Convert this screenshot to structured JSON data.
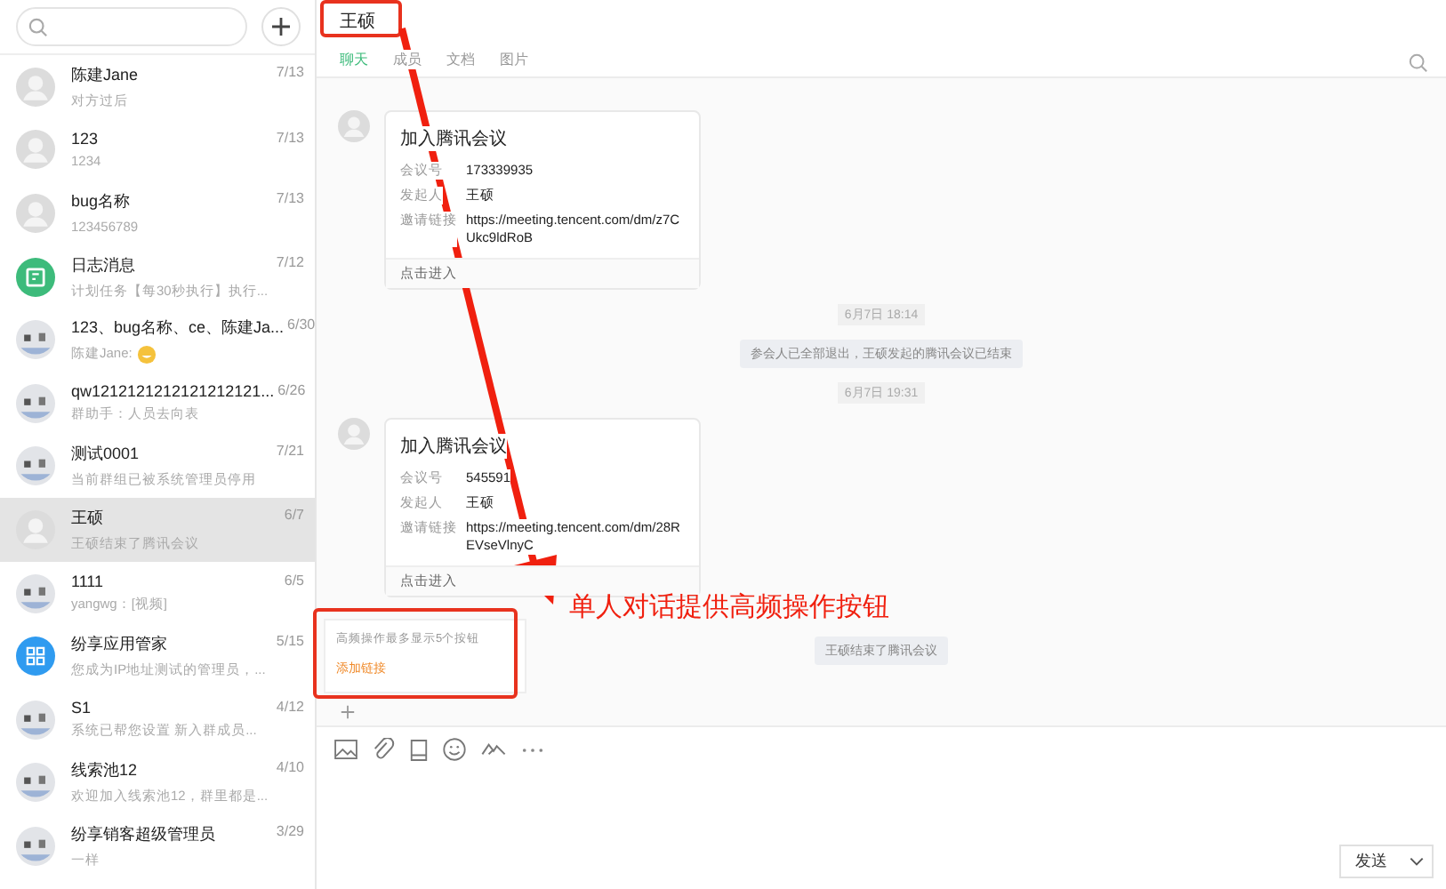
{
  "conversations": [
    {
      "name": "陈建Jane",
      "preview": "对方过后",
      "time": "7/13",
      "kind": "person",
      "selected": false
    },
    {
      "name": "123",
      "preview": "1234",
      "time": "7/13",
      "kind": "person",
      "selected": false
    },
    {
      "name": "bug名称",
      "preview": "123456789",
      "time": "7/13",
      "kind": "person",
      "selected": false
    },
    {
      "name": "日志消息",
      "preview": "计划任务【每30秒执行】执行...",
      "time": "7/12",
      "kind": "app-green",
      "selected": false
    },
    {
      "name": "123、bug名称、ce、陈建Ja...",
      "preview": "陈建Jane:",
      "emoji": true,
      "time": "6/30",
      "kind": "group",
      "selected": false
    },
    {
      "name": "qw1212121212121212121...",
      "preview": "群助手：人员去向表",
      "time": "6/26",
      "kind": "group",
      "selected": false
    },
    {
      "name": "测试0001",
      "preview": "当前群组已被系统管理员停用",
      "time": "7/21",
      "kind": "group",
      "selected": false
    },
    {
      "name": "王硕",
      "preview": "王硕结束了腾讯会议",
      "time": "6/7",
      "kind": "person",
      "selected": true
    },
    {
      "name": "1111",
      "preview": "yangwg：[视频]",
      "time": "6/5",
      "kind": "group",
      "selected": false
    },
    {
      "name": "纷享应用管家",
      "preview": "您成为IP地址测试的管理员，...",
      "time": "5/15",
      "kind": "app-blue",
      "selected": false
    },
    {
      "name": "S1",
      "preview": "系统已帮您设置 新入群成员...",
      "time": "4/12",
      "kind": "group",
      "selected": false
    },
    {
      "name": "线索池12",
      "preview": "欢迎加入线索池12，群里都是...",
      "time": "4/10",
      "kind": "group",
      "selected": false
    },
    {
      "name": "纷享销客超级管理员",
      "preview": "一样",
      "time": "3/29",
      "kind": "group",
      "selected": false
    }
  ],
  "chat": {
    "title": "王硕",
    "tabs": [
      {
        "label": "聊天",
        "selected": true
      },
      {
        "label": "成员",
        "selected": false
      },
      {
        "label": "文档",
        "selected": false
      },
      {
        "label": "图片",
        "selected": false
      }
    ],
    "messages": [
      {
        "kind": "card",
        "title": "加入腾讯会议",
        "rows": [
          {
            "label": "会议号",
            "value": "173339935"
          },
          {
            "label": "发起人",
            "value": "王硕"
          },
          {
            "label": "邀请链接",
            "value": "https://meeting.tencent.com/dm/z7CUkc9ldRoB"
          }
        ],
        "footer": "点击进入"
      },
      {
        "kind": "time",
        "text": "6月7日 18:14"
      },
      {
        "kind": "system",
        "text": "参会人已全部退出，王硕发起的腾讯会议已结束"
      },
      {
        "kind": "time",
        "text": "6月7日 19:31"
      },
      {
        "kind": "card",
        "title": "加入腾讯会议",
        "rows": [
          {
            "label": "会议号",
            "value": "545591"
          },
          {
            "label": "发起人",
            "value": "王硕"
          },
          {
            "label": "邀请链接",
            "value": "https://meeting.tencent.com/dm/28REVseVlnyC"
          }
        ],
        "footer": "点击进入"
      },
      {
        "kind": "system",
        "text": "王硕结束了腾讯会议"
      }
    ]
  },
  "quick_actions": {
    "hint": "高频操作最多显示5个按钮",
    "links": [
      "添加链接"
    ]
  },
  "composer": {
    "send_button": "发送"
  },
  "annotation": {
    "text": "单人对话提供高频操作按钮"
  }
}
